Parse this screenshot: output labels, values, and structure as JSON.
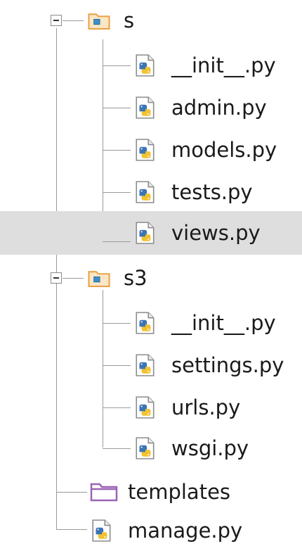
{
  "tree": {
    "packages": [
      {
        "name": "s",
        "expanded": true,
        "files": [
          {
            "name": "__init__.py"
          },
          {
            "name": "admin.py"
          },
          {
            "name": "models.py"
          },
          {
            "name": "tests.py"
          },
          {
            "name": "views.py",
            "selected": true
          }
        ]
      },
      {
        "name": "s3",
        "expanded": true,
        "files": [
          {
            "name": "__init__.py"
          },
          {
            "name": "settings.py"
          },
          {
            "name": "urls.py"
          },
          {
            "name": "wsgi.py"
          }
        ]
      }
    ],
    "folders": [
      {
        "name": "templates"
      }
    ],
    "root_files": [
      {
        "name": "manage.py"
      }
    ]
  },
  "colors": {
    "selection_bg": "#dedede",
    "package_folder": "#e9a34b",
    "templates_folder": "#9b63b5",
    "python_blue": "#3d74b4",
    "python_yellow": "#f2c230",
    "tree_line": "#9a9a9a"
  },
  "icons": {
    "package": "package-folder-icon",
    "folder": "folder-icon",
    "python_file": "python-file-icon",
    "collapse": "collapse-toggle-icon"
  }
}
